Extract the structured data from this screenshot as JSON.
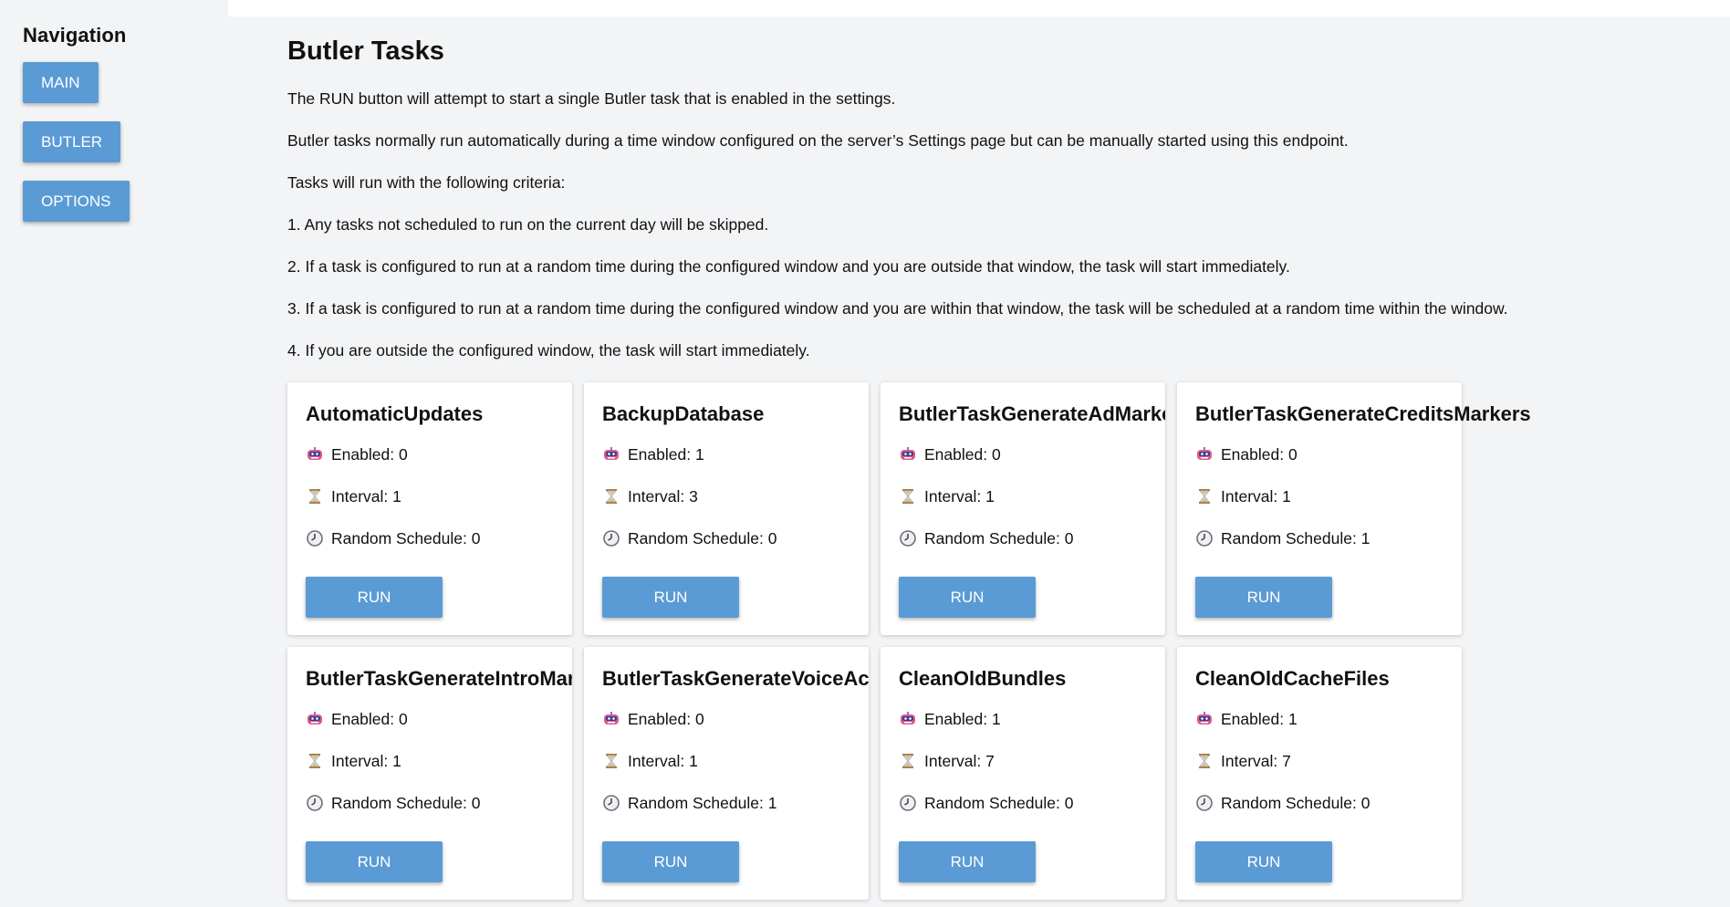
{
  "sidebar": {
    "title": "Navigation",
    "buttons": [
      "MAIN",
      "BUTLER",
      "OPTIONS"
    ]
  },
  "main": {
    "title": "Butler Tasks",
    "paragraphs": [
      "The RUN button will attempt to start a single Butler task that is enabled in the settings.",
      "Butler tasks normally run automatically during a time window configured on the server’s Settings page but can be manually started using this endpoint.",
      "Tasks will run with the following criteria:",
      "1. Any tasks not scheduled to run on the current day will be skipped.",
      "2. If a task is configured to run at a random time during the configured window and you are outside that window, the task will start immediately.",
      "3. If a task is configured to run at a random time during the configured window and you are within that window, the task will be scheduled at a random time within the window.",
      "4. If you are outside the configured window, the task will start immediately."
    ]
  },
  "tasks": [
    {
      "name": "AutomaticUpdates",
      "enabled": "Enabled: 0",
      "interval": "Interval: 1",
      "random": "Random Schedule: 0",
      "run": "RUN"
    },
    {
      "name": "BackupDatabase",
      "enabled": "Enabled: 1",
      "interval": "Interval: 3",
      "random": "Random Schedule: 0",
      "run": "RUN"
    },
    {
      "name": "ButlerTaskGenerateAdMarkers",
      "enabled": "Enabled: 0",
      "interval": "Interval: 1",
      "random": "Random Schedule: 0",
      "run": "RUN"
    },
    {
      "name": "ButlerTaskGenerateCreditsMarkers",
      "enabled": "Enabled: 0",
      "interval": "Interval: 1",
      "random": "Random Schedule: 1",
      "run": "RUN"
    },
    {
      "name": "ButlerTaskGenerateIntroMarkers",
      "enabled": "Enabled: 0",
      "interval": "Interval: 1",
      "random": "Random Schedule: 0",
      "run": "RUN"
    },
    {
      "name": "ButlerTaskGenerateVoiceActivity",
      "enabled": "Enabled: 0",
      "interval": "Interval: 1",
      "random": "Random Schedule: 1",
      "run": "RUN"
    },
    {
      "name": "CleanOldBundles",
      "enabled": "Enabled: 1",
      "interval": "Interval: 7",
      "random": "Random Schedule: 0",
      "run": "RUN"
    },
    {
      "name": "CleanOldCacheFiles",
      "enabled": "Enabled: 1",
      "interval": "Interval: 7",
      "random": "Random Schedule: 0",
      "run": "RUN"
    }
  ],
  "icons": {
    "enabled": "robot-icon",
    "interval": "hourglass-icon",
    "random": "clock-icon"
  },
  "colors": {
    "accent": "#5b9bd5"
  }
}
